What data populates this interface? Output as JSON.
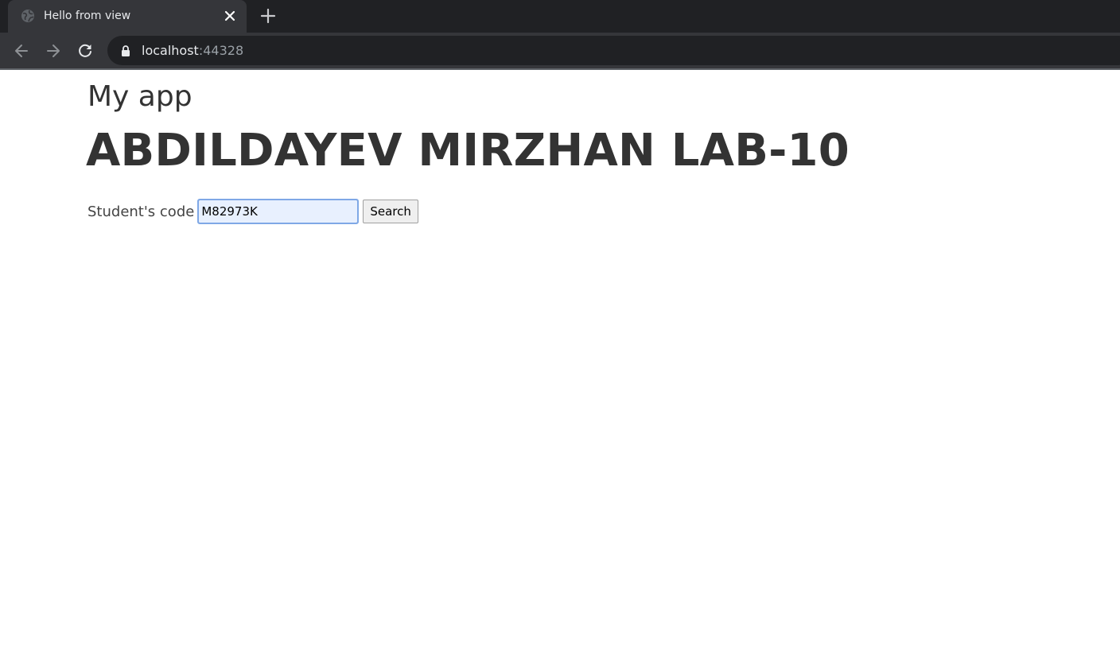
{
  "browser": {
    "tab": {
      "title": "Hello from view",
      "favicon": "globe-icon",
      "close_icon": "close-icon"
    },
    "new_tab_icon": "plus-icon",
    "nav": {
      "back_icon": "arrow-left-icon",
      "forward_icon": "arrow-right-icon",
      "reload_icon": "reload-icon"
    },
    "address_bar": {
      "lock_icon": "lock-icon",
      "host": "localhost",
      "port": ":44328"
    },
    "colors": {
      "tabstrip": "#202124",
      "toolbar": "#35363a",
      "omnibox": "#202124"
    }
  },
  "page": {
    "app_title": "My app",
    "lab_title": "ABDILDAYEV MIRZHAN LAB-10",
    "search": {
      "label": "Student's code",
      "input_value": "M82973K",
      "button_label": "Search"
    },
    "colors": {
      "heading_text": "#333333",
      "input_background": "#e8f0fe",
      "input_focus": "#7fa8e6"
    }
  }
}
